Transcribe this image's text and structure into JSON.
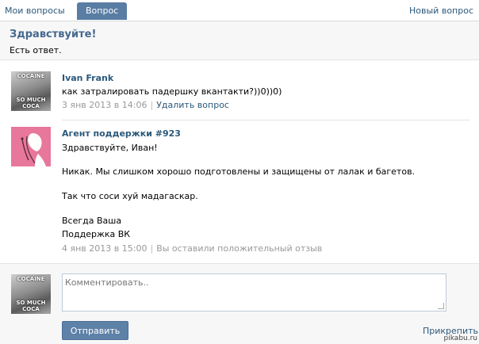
{
  "tabs": {
    "my_questions": "Мои вопросы",
    "question": "Вопрос",
    "new_question": "Новый вопрос"
  },
  "question": {
    "greeting": "Здравствуйте!",
    "subtitle": "Есть ответ."
  },
  "messages": [
    {
      "author": "Ivan Frank",
      "avatar_caption_top": "COCAINE",
      "avatar_caption_bottom": "SO MUCH COCA",
      "text": "как затралировать падершку вкантакти?))0))0)",
      "date": "3 янв 2013 в 14:06",
      "action": "Удалить вопрос"
    },
    {
      "author": "Агент поддержки #923",
      "lines": [
        "Здравствуйте, Иван!",
        "Никак. Мы слишком хорошо подготовлены и защищены от лалак и багетов.",
        "Так что соси хуй мадагаскар.",
        "Всегда Ваша",
        "Поддержка ВК"
      ],
      "date": "4 янв 2013 в 15:00",
      "status": "Вы оставили положительный отзыв"
    }
  ],
  "comment": {
    "placeholder": "Комментировать..",
    "submit": "Отправить",
    "attach": "Прикрепить",
    "avatar_caption_top": "COCAINE",
    "avatar_caption_bottom": "SO MUCH COCA"
  },
  "watermark": "pikabu.ru"
}
